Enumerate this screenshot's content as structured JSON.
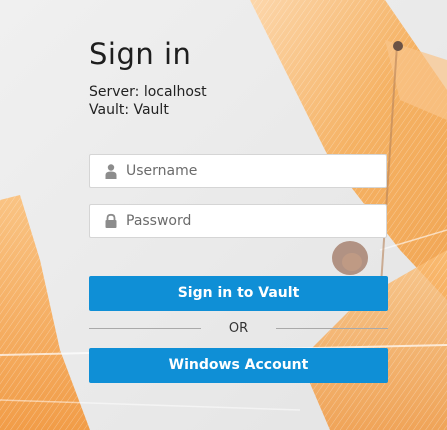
{
  "login": {
    "title": "Sign in",
    "server_line": "Server: localhost",
    "vault_line": "Vault: Vault",
    "username_placeholder": "Username",
    "username_value": "",
    "password_placeholder": "Password",
    "password_value": "",
    "signin_button_label": "Sign in to Vault",
    "or_label": "OR",
    "windows_button_label": "Windows Account"
  },
  "colors": {
    "primary_button": "#0f8fd6",
    "background": "#ebebeb",
    "accent_art": "#f5a24a"
  },
  "icons": {
    "username": "user-icon",
    "password": "lock-icon"
  }
}
